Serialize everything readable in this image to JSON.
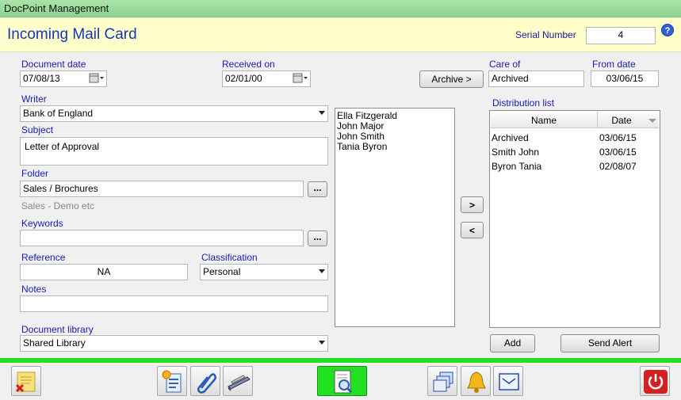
{
  "window": {
    "app_title": "DocPoint  Management"
  },
  "header": {
    "title": "Incoming Mail Card",
    "serial_label": "Serial Number",
    "serial_value": "4"
  },
  "form": {
    "document_date": {
      "label": "Document date",
      "value": "07/08/13"
    },
    "received_on": {
      "label": "Received on",
      "value": "02/01/00"
    },
    "archive_button": "Archive >",
    "care_of": {
      "label": "Care of",
      "value": "Archived"
    },
    "from_date": {
      "label": "From date",
      "value": "03/06/15"
    },
    "writer": {
      "label": "Writer",
      "value": "Bank of England"
    },
    "subject": {
      "label": "Subject",
      "value": "Letter of Approval"
    },
    "folder": {
      "label": "Folder",
      "value": "Sales / Brochures",
      "hint": "Sales - Demo etc",
      "browse": "..."
    },
    "keywords": {
      "label": "Keywords",
      "value": "",
      "browse": "..."
    },
    "reference": {
      "label": "Reference",
      "value": "NA"
    },
    "classification": {
      "label": "Classification",
      "value": "Personal"
    },
    "notes": {
      "label": "Notes",
      "value": ""
    },
    "document_library": {
      "label": "Document library",
      "value": "Shared Library"
    }
  },
  "available_people": [
    "Ella Fitzgerald",
    "John Major",
    "John Smith",
    "Tania Byron"
  ],
  "move_buttons": {
    "add": ">",
    "remove": "<"
  },
  "distribution": {
    "label": "Distribution list",
    "columns": [
      "Name",
      "Date"
    ],
    "rows": [
      {
        "name": "Archived",
        "date": "03/06/15"
      },
      {
        "name": "Smith John",
        "date": "03/06/15"
      },
      {
        "name": "Byron Tania",
        "date": "02/08/07"
      }
    ],
    "add_button": "Add",
    "send_alert_button": "Send Alert"
  },
  "toolbar": {
    "icons": [
      "delete-note-icon",
      "new-document-icon",
      "attachment-icon",
      "scanner-icon",
      "search-document-icon",
      "copy-windows-icon",
      "bell-icon",
      "mail-icon",
      "power-icon"
    ]
  },
  "colors": {
    "accent_green": "#22e022",
    "header_yellow": "#ffffcc",
    "title_blue": "#1536b5",
    "power_red": "#d42020"
  }
}
